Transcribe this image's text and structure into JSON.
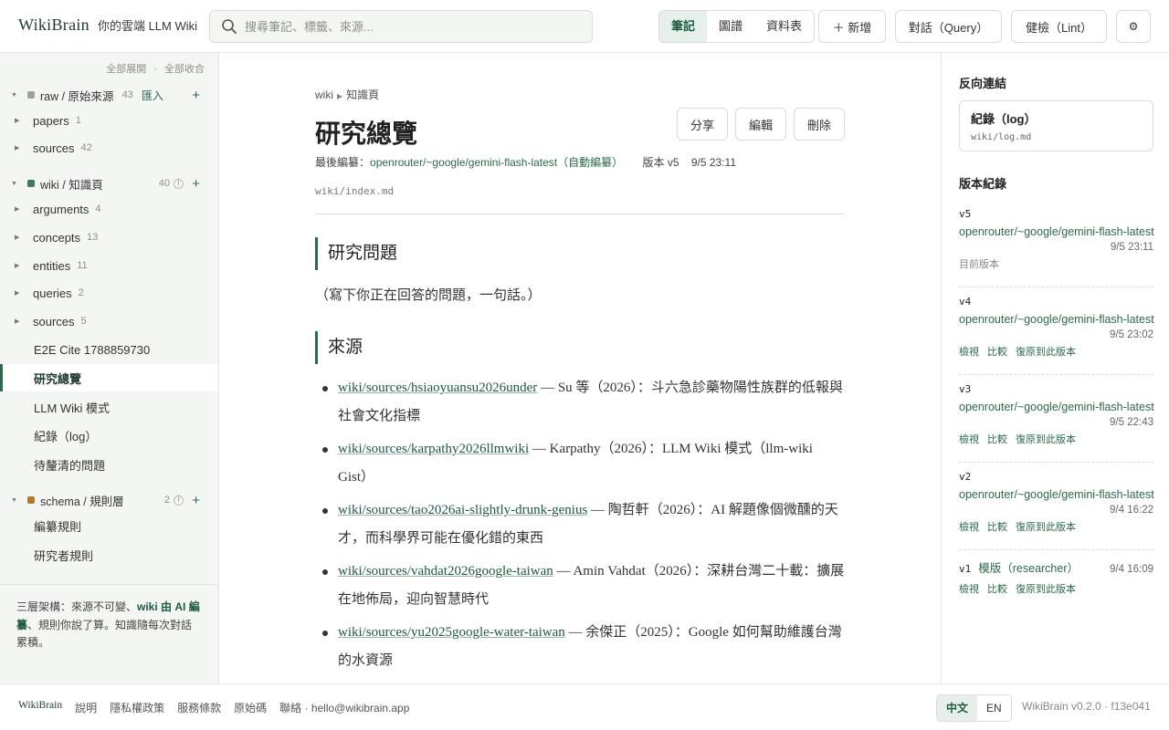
{
  "header": {
    "brand": "WikiBrain",
    "tagline": "你的雲端 LLM Wiki",
    "search_placeholder": "搜尋筆記、標籤、來源...",
    "search_icon": "search-icon",
    "views": [
      "筆記",
      "圖譜",
      "資料表"
    ],
    "active_view": "筆記",
    "new_label": "＋ 新增",
    "query_label": "對話（Query）",
    "lint_label": "健檢（Lint）",
    "settings_glyph": "⚙"
  },
  "sidebar": {
    "expand_all": "全部展開",
    "collapse_all": "全部收合",
    "separator": "·",
    "raw": {
      "label": "raw / 原始來源",
      "count": "43",
      "action": "匯入",
      "color": "#9aa59e",
      "items": [
        {
          "label": "papers",
          "count": "1"
        },
        {
          "label": "sources",
          "count": "42"
        }
      ]
    },
    "wiki": {
      "label": "wiki / 知識頁",
      "count": "40",
      "color": "#3f7a5c",
      "items": [
        {
          "label": "arguments",
          "count": "4"
        },
        {
          "label": "concepts",
          "count": "13"
        },
        {
          "label": "entities",
          "count": "11"
        },
        {
          "label": "queries",
          "count": "2"
        },
        {
          "label": "sources",
          "count": "5"
        }
      ],
      "pages": [
        "E2E Cite 1788859730",
        "研究總覽",
        "LLM Wiki 模式",
        "紀錄（log）",
        "待釐清的問題"
      ]
    },
    "schema": {
      "label": "schema / 規則層",
      "count": "2",
      "color": "#b07a2c",
      "pages": [
        "編纂規則",
        "研究者規則"
      ]
    },
    "footer_a": "三層架構：來源不可變、",
    "footer_b": "wiki 由 AI 編纂",
    "footer_c": "、規則你說了算。知識隨每次對話累積。"
  },
  "main": {
    "breadcrumb": [
      "wiki",
      "知識頁"
    ],
    "title": "研究總覽",
    "share": "分享",
    "edit": "編輯",
    "delete": "刪除",
    "meta_prefix": "最後編纂：",
    "meta_model": "openrouter/~google/gemini-flash-latest（自動編纂）",
    "meta_version": "版本 v5",
    "meta_time": "9/5 23:11",
    "path": "wiki/index.md",
    "section1": "研究問題",
    "section1_text": "（寫下你正在回答的問題，一句話。）",
    "section2": "來源",
    "refs": [
      {
        "link": "wiki/sources/hsiaoyuansu2026under",
        "text": " — Su 等（2026）：斗六急診藥物陽性族群的低報與社會文化指標"
      },
      {
        "link": "wiki/sources/karpathy2026llmwiki",
        "text": " — Karpathy（2026）：LLM Wiki 模式（llm-wiki Gist）"
      },
      {
        "link": "wiki/sources/tao2026ai-slightly-drunk-genius",
        "text": " — 陶哲軒（2026）：AI 解題像個微醺的天才，而科學界可能在優化錯的東西"
      },
      {
        "link": "wiki/sources/vahdat2026google-taiwan",
        "text": " — Amin Vahdat（2026）：深耕台灣二十載：擴展在地佈局，迎向智慧時代"
      },
      {
        "link": "wiki/sources/yu2025google-water-taiwan",
        "text": " — 余傑正（2025）：Google 如何幫助維護台灣的水資源"
      }
    ]
  },
  "right": {
    "backlinks_title": "反向連結",
    "backlink": {
      "title": "紀錄（log）",
      "path": "wiki/log.md"
    },
    "history_title": "版本紀錄",
    "versions": [
      {
        "v": "v5",
        "model": "openrouter/~google/gemini-flash-latest",
        "time": "9/5 23:11",
        "current": "目前版本"
      },
      {
        "v": "v4",
        "model": "openrouter/~google/gemini-flash-latest",
        "time": "9/5 23:02"
      },
      {
        "v": "v3",
        "model": "openrouter/~google/gemini-flash-latest",
        "time": "9/5 22:43"
      },
      {
        "v": "v2",
        "model": "openrouter/~google/gemini-flash-latest",
        "time": "9/4 16:22"
      },
      {
        "v": "v1",
        "model": "模版（researcher）",
        "time": "9/4 16:09"
      }
    ],
    "view": "檢視",
    "compare": "比較",
    "restore": "復原到此版本"
  },
  "footer": {
    "brand": "WikiBrain",
    "links": [
      "說明",
      "隱私權政策",
      "服務條款",
      "原始碼",
      "聯絡 · hello@wikibrain.app"
    ],
    "lang_zh": "中文",
    "lang_en": "EN",
    "version": "WikiBrain v0.2.0 · f13e041"
  }
}
